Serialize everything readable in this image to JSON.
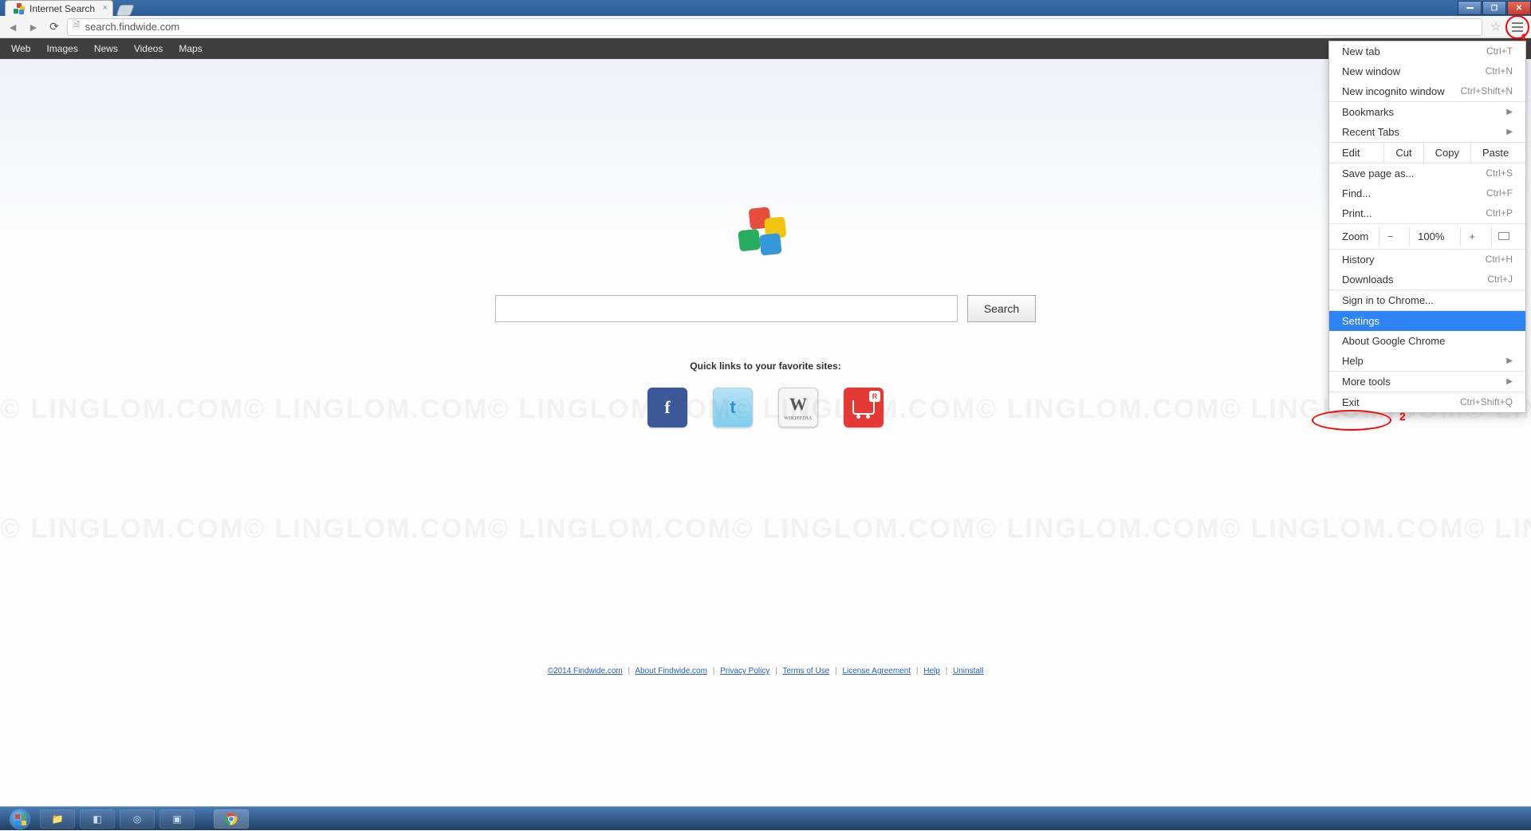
{
  "window": {
    "tab_title": "Internet Search",
    "url": "search.findwide.com"
  },
  "site_nav": [
    "Web",
    "Images",
    "News",
    "Videos",
    "Maps"
  ],
  "search": {
    "value": "",
    "button": "Search"
  },
  "quick_links_label": "Quick links to your favorite sites:",
  "quick_links": {
    "facebook": "f",
    "twitter": "t",
    "wikipedia_main": "W",
    "wikipedia_sub": "WIKIPEDIA",
    "shop_badge": "R"
  },
  "footer": {
    "copyright": "©2014 Findwide.com",
    "links": [
      "About Findwide.com",
      "Privacy Policy",
      "Terms of Use",
      "License Agreement",
      "Help",
      "Uninstall"
    ]
  },
  "watermark_item": "© LINGLOM.COM",
  "menu": {
    "new_tab": {
      "label": "New tab",
      "sc": "Ctrl+T"
    },
    "new_window": {
      "label": "New window",
      "sc": "Ctrl+N"
    },
    "new_incognito": {
      "label": "New incognito window",
      "sc": "Ctrl+Shift+N"
    },
    "bookmarks": {
      "label": "Bookmarks"
    },
    "recent_tabs": {
      "label": "Recent Tabs"
    },
    "edit": "Edit",
    "cut": "Cut",
    "copy": "Copy",
    "paste": "Paste",
    "save_page": {
      "label": "Save page as...",
      "sc": "Ctrl+S"
    },
    "find": {
      "label": "Find...",
      "sc": "Ctrl+F"
    },
    "print": {
      "label": "Print...",
      "sc": "Ctrl+P"
    },
    "zoom_label": "Zoom",
    "zoom_minus": "−",
    "zoom_value": "100%",
    "zoom_plus": "+",
    "history": {
      "label": "History",
      "sc": "Ctrl+H"
    },
    "downloads": {
      "label": "Downloads",
      "sc": "Ctrl+J"
    },
    "sign_in": "Sign in to Chrome...",
    "settings": "Settings",
    "about": "About Google Chrome",
    "help": "Help",
    "more_tools": "More tools",
    "exit": {
      "label": "Exit",
      "sc": "Ctrl+Shift+Q"
    }
  },
  "annotations": {
    "num1": "1",
    "num2": "2"
  }
}
